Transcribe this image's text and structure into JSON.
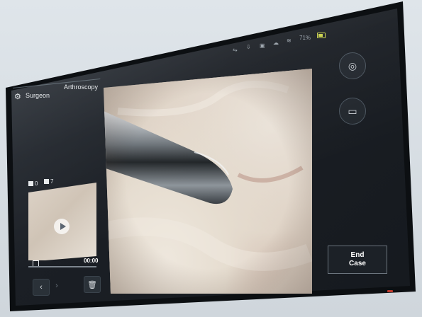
{
  "tabs": {
    "surgeon": "Surgeon",
    "procedure": "Arthroscopy"
  },
  "status": {
    "battery_percent": "71%",
    "battery_color": "#c9d24a"
  },
  "media_counts": {
    "photos": "0",
    "videos": "7"
  },
  "thumbnail": {
    "duration": "00:00"
  },
  "buttons": {
    "prev": "‹",
    "next": "›",
    "delete_icon": "trash-icon",
    "capture_photo_icon": "camera-icon",
    "record_video_icon": "video-camera-icon",
    "end_case_line1": "End",
    "end_case_line2": "Case"
  },
  "colors": {
    "screen_bg": "#1b1f25",
    "accent_led": "#c0392b"
  }
}
